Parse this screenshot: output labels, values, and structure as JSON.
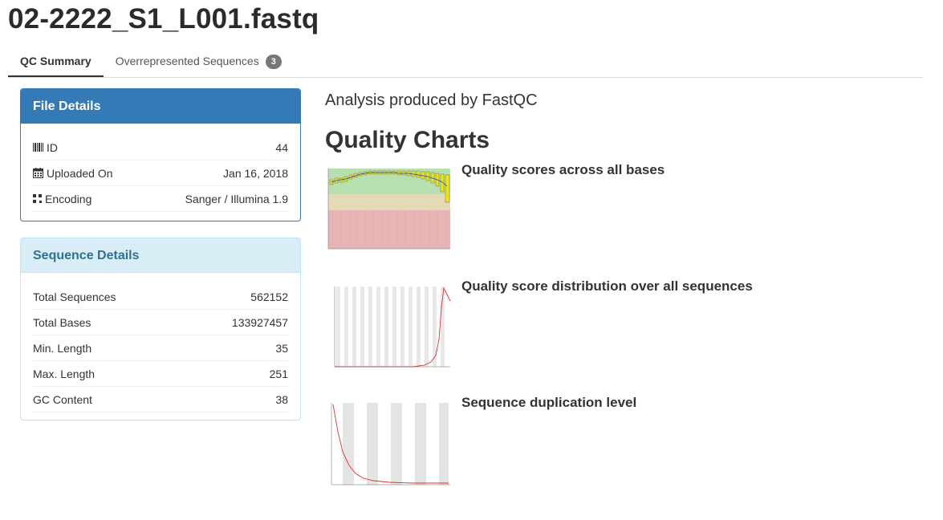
{
  "page": {
    "title": "02-2222_S1_L001.fastq"
  },
  "tabs": [
    {
      "label": "QC Summary",
      "active": true
    },
    {
      "label": "Overrepresented Sequences",
      "badge": "3",
      "active": false
    }
  ],
  "file_details": {
    "heading": "File Details",
    "rows": [
      {
        "icon": "barcode-icon",
        "label": "ID",
        "value": "44"
      },
      {
        "icon": "calendar-icon",
        "label": "Uploaded On",
        "value": "Jan 16, 2018"
      },
      {
        "icon": "qrcode-icon",
        "label": "Encoding",
        "value": "Sanger / Illumina 1.9"
      }
    ]
  },
  "sequence_details": {
    "heading": "Sequence Details",
    "rows": [
      {
        "label": "Total Sequences",
        "value": "562152"
      },
      {
        "label": "Total Bases",
        "value": "133927457"
      },
      {
        "label": "Min. Length",
        "value": "35"
      },
      {
        "label": "Max. Length",
        "value": "251"
      },
      {
        "label": "GC Content",
        "value": "38"
      }
    ]
  },
  "main": {
    "analysis_text": "Analysis produced by FastQC",
    "heading": "Quality Charts",
    "charts": [
      {
        "caption": "Quality scores across all bases"
      },
      {
        "caption": "Quality score distribution over all sequences"
      },
      {
        "caption": "Sequence duplication level"
      }
    ]
  },
  "colors": {
    "primary": "#337ab7",
    "info_bg": "#d9edf7",
    "info_text": "#31708f",
    "badge": "#777777"
  }
}
